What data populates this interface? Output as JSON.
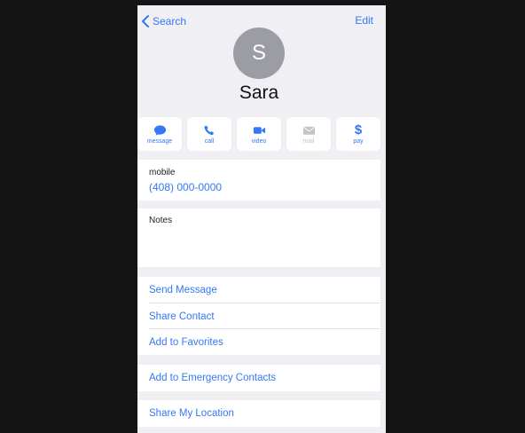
{
  "nav": {
    "back_label": "Search",
    "edit_label": "Edit"
  },
  "contact": {
    "initial": "S",
    "name": "Sara"
  },
  "actions": [
    {
      "label": "message",
      "icon": "message-bubble-icon",
      "enabled": true
    },
    {
      "label": "call",
      "icon": "phone-icon",
      "enabled": true
    },
    {
      "label": "video",
      "icon": "video-camera-icon",
      "enabled": true
    },
    {
      "label": "mail",
      "icon": "envelope-icon",
      "enabled": false
    },
    {
      "label": "pay",
      "icon": "dollar-icon",
      "enabled": true
    }
  ],
  "phone": {
    "label": "mobile",
    "value": "(408) 000-0000"
  },
  "notes": {
    "label": "Notes"
  },
  "list": {
    "send_message": "Send Message",
    "share_contact": "Share Contact",
    "add_favorites": "Add to Favorites"
  },
  "emergency": "Add to Emergency Contacts",
  "share_location": "Share My Location",
  "colors": {
    "accent": "#3478f6",
    "background": "#efeff4",
    "avatar": "#9b9ca4"
  }
}
